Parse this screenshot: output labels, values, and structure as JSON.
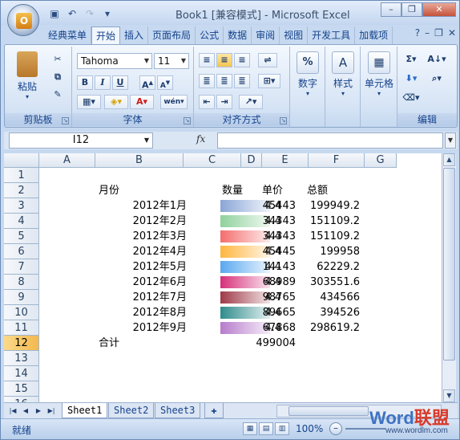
{
  "window": {
    "title": "Book1  [兼容模式] - Microsoft Excel",
    "orb_label": "O"
  },
  "qat": {
    "icons": [
      "save-icon",
      "undo-icon",
      "redo-icon",
      "customize-icon"
    ]
  },
  "tabs": [
    "经典菜单",
    "开始",
    "插入",
    "页面布局",
    "公式",
    "数据",
    "审阅",
    "视图",
    "开发工具",
    "加载项"
  ],
  "active_tab": "开始",
  "ribbon": {
    "clipboard": {
      "label": "剪贴板",
      "paste": "粘贴"
    },
    "font": {
      "label": "字体",
      "family": "Tahoma",
      "size": "11",
      "bold": "B",
      "italic": "I",
      "underline": "U"
    },
    "alignment": {
      "label": "对齐方式"
    },
    "number": {
      "label": "数字",
      "btn": "数字",
      "symbol": "%"
    },
    "styles": {
      "btn": "样式"
    },
    "cells": {
      "btn": "单元格"
    },
    "editing": {
      "label": "编辑",
      "sigma": "Σ"
    }
  },
  "formula_bar": {
    "name_box": "I12",
    "fx": "fx",
    "formula": ""
  },
  "columns": [
    "A",
    "B",
    "C",
    "D",
    "E",
    "F",
    "G"
  ],
  "rows": [
    "1",
    "2",
    "3",
    "4",
    "5",
    "6",
    "7",
    "8",
    "9",
    "10",
    "11",
    "12",
    "13",
    "14",
    "15",
    "16"
  ],
  "selected_row": "12",
  "sheet": {
    "headers": {
      "month": "月份",
      "qty": "数量",
      "price": "单价",
      "total": "总额"
    },
    "data": [
      {
        "month": "2012年1月",
        "qty": "45443",
        "price": "4.4",
        "total": "199949.2",
        "color": "#8aa6d6"
      },
      {
        "month": "2012年2月",
        "qty": "34343",
        "price": "4.4",
        "total": "151109.2",
        "color": "#8fd19c"
      },
      {
        "month": "2012年3月",
        "qty": "34343",
        "price": "4.4",
        "total": "151109.2",
        "color": "#f46e6e"
      },
      {
        "month": "2012年4月",
        "qty": "45445",
        "price": "4.4",
        "total": "199958",
        "color": "#ffb640"
      },
      {
        "month": "2012年5月",
        "qty": "14143",
        "price": "4.4",
        "total": "62229.2",
        "color": "#5aa8f0"
      },
      {
        "month": "2012年6月",
        "qty": "68989",
        "price": "4.4",
        "total": "303551.6",
        "color": "#d6307a"
      },
      {
        "month": "2012年7月",
        "qty": "98765",
        "price": "4.4",
        "total": "434566",
        "color": "#9e3a48"
      },
      {
        "month": "2012年8月",
        "qty": "89665",
        "price": "4.4",
        "total": "394526",
        "color": "#2f8c8c"
      },
      {
        "month": "2012年9月",
        "qty": "67868",
        "price": "4.4",
        "total": "298619.2",
        "color": "#b77ccc"
      }
    ],
    "total_label": "合计",
    "total_qty": "499004"
  },
  "sheet_tabs": [
    "Sheet1",
    "Sheet2",
    "Sheet3"
  ],
  "active_sheet": "Sheet1",
  "status": {
    "text": "就绪",
    "zoom": "100%"
  },
  "watermark": {
    "word": "Word",
    "lm": "联盟",
    "url": "www.wordlm.com"
  }
}
